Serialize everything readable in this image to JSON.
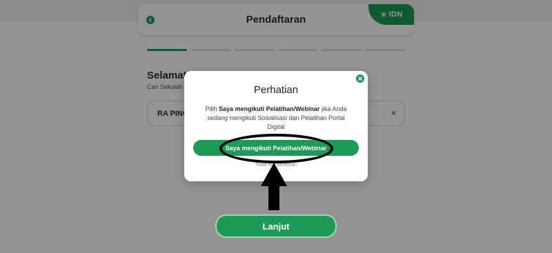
{
  "header": {
    "title": "Pendaftaran",
    "brand": "IDN"
  },
  "progress": {
    "total_steps": 6,
    "current_step": 1
  },
  "content": {
    "welcome_title": "Selamat",
    "welcome_subtitle": "Cari Sekolah",
    "school_value": "RA PINC",
    "clear_symbol": "×"
  },
  "footer": {
    "next_label": "Lanjut"
  },
  "modal": {
    "title": "Perhatian",
    "body_prefix": "Pilih ",
    "body_bold": "Saya mengikuti Pelatihan/Webinar",
    "body_suffix": " jika Anda sedang mengikuti Sosialisasi dan Pelatihan Portal Digital",
    "primary_label": "Saya mengikuti Pelatihan/Webinar",
    "secondary_label": "Tidak ikut pelatihan"
  },
  "colors": {
    "accent": "#1d9a55",
    "overlay": "rgba(0,0,0,0.42)"
  }
}
